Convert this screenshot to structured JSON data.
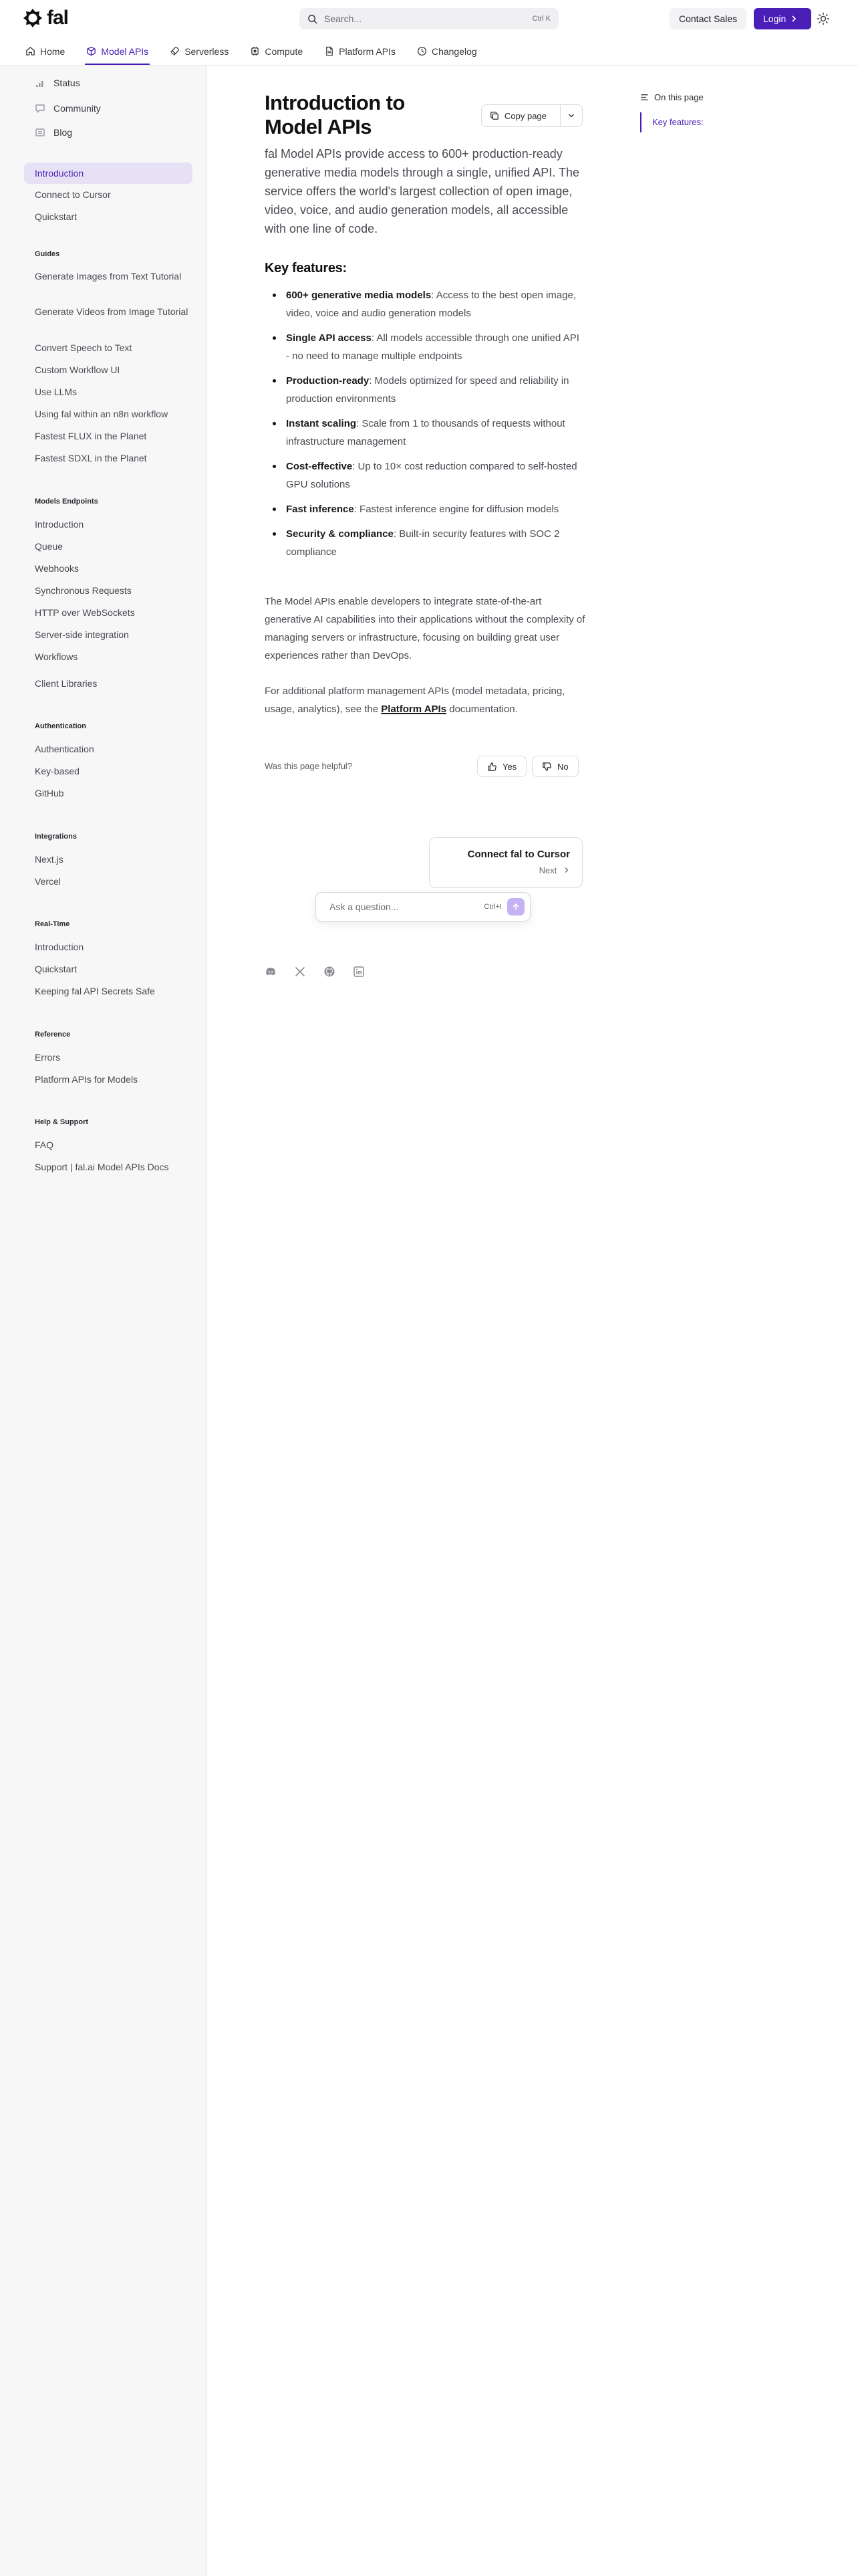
{
  "brand": {
    "name": "fal",
    "accent": "#4a1fb8"
  },
  "header": {
    "search_placeholder": "Search...",
    "search_shortcut": "Ctrl K",
    "contact_sales": "Contact Sales",
    "login": "Login"
  },
  "nav": {
    "tabs": [
      {
        "label": "Home",
        "icon": "home-icon"
      },
      {
        "label": "Model APIs",
        "icon": "cube-icon",
        "active": true
      },
      {
        "label": "Serverless",
        "icon": "rocket-icon"
      },
      {
        "label": "Compute",
        "icon": "cpu-icon"
      },
      {
        "label": "Platform APIs",
        "icon": "document-icon"
      },
      {
        "label": "Changelog",
        "icon": "clock-icon"
      }
    ]
  },
  "sidebar": {
    "top_links": [
      {
        "label": "Status",
        "icon": "signal-icon"
      },
      {
        "label": "Community",
        "icon": "chat-icon"
      },
      {
        "label": "Blog",
        "icon": "newspaper-icon"
      }
    ],
    "intro_items": [
      "Introduction",
      "Connect to Cursor",
      "Quickstart"
    ],
    "groups": [
      {
        "title": "Guides",
        "items": [
          "Generate Images from Text Tutorial",
          "Generate Videos from Image Tutorial",
          "Convert Speech to Text",
          "Custom Workflow UI",
          "Use LLMs",
          "Using fal within an n8n workflow",
          "Fastest FLUX in the Planet",
          "Fastest SDXL in the Planet"
        ]
      },
      {
        "title": "Models Endpoints",
        "items": [
          "Introduction",
          "Queue",
          "Webhooks",
          "Synchronous Requests",
          "HTTP over WebSockets",
          "Server-side integration",
          "Workflows",
          "Client Libraries"
        ]
      },
      {
        "title": "Authentication",
        "items": [
          "Authentication",
          "Key-based",
          "GitHub"
        ]
      },
      {
        "title": "Integrations",
        "items": [
          "Next.js",
          "Vercel"
        ]
      },
      {
        "title": "Real-Time",
        "items": [
          "Introduction",
          "Quickstart",
          "Keeping fal API Secrets Safe"
        ]
      },
      {
        "title": "Reference",
        "items": [
          "Errors",
          "Platform APIs for Models"
        ]
      },
      {
        "title": "Help & Support",
        "items": [
          "FAQ",
          "Support | fal.ai Model APIs Docs"
        ]
      }
    ]
  },
  "main": {
    "title": "Introduction to Model APIs",
    "copy_page": "Copy page",
    "lead": "fal Model APIs provide access to 600+ production-ready generative media models through a single, unified API. The service offers the world's largest collection of open image, video, voice, and audio generation models, all accessible with one line of code.",
    "features_heading": "Key features:",
    "features": [
      {
        "name": "600+ generative media models",
        "desc": ": Access to the best open image, video, voice and audio generation models"
      },
      {
        "name": "Single API access",
        "desc": ": All models accessible through one unified API - no need to manage multiple endpoints"
      },
      {
        "name": "Production-ready",
        "desc": ": Models optimized for speed and reliability in production environments"
      },
      {
        "name": "Instant scaling",
        "desc": ": Scale from 1 to thousands of requests without infrastructure management"
      },
      {
        "name": "Cost-effective",
        "desc": ": Up to 10× cost reduction compared to self-hosted GPU solutions"
      },
      {
        "name": "Fast inference",
        "desc": ": Fastest inference engine for diffusion models"
      },
      {
        "name": "Security & compliance",
        "desc": ": Built-in security features with SOC 2 compliance"
      }
    ],
    "para1": "The Model APIs enable developers to integrate state-of-the-art generative AI capabilities into their applications without the complexity of managing servers or infrastructure, focusing on building great user experiences rather than DevOps.",
    "para2_before": "For additional platform management APIs (model metadata, pricing, usage, analytics), see the ",
    "para2_link": "Platform APIs",
    "para2_after": " documentation.",
    "helpful_question": "Was this page helpful?",
    "vote_yes": "Yes",
    "vote_no": "No",
    "next_title": "Connect fal to Cursor",
    "next_label": "Next",
    "ask_placeholder": "Ask a question...",
    "ask_shortcut": "Ctrl+I",
    "socials": [
      "discord-icon",
      "x-icon",
      "github-icon",
      "linkedin-icon"
    ]
  },
  "toc": {
    "heading": "On this page",
    "items": [
      "Key features:"
    ]
  }
}
